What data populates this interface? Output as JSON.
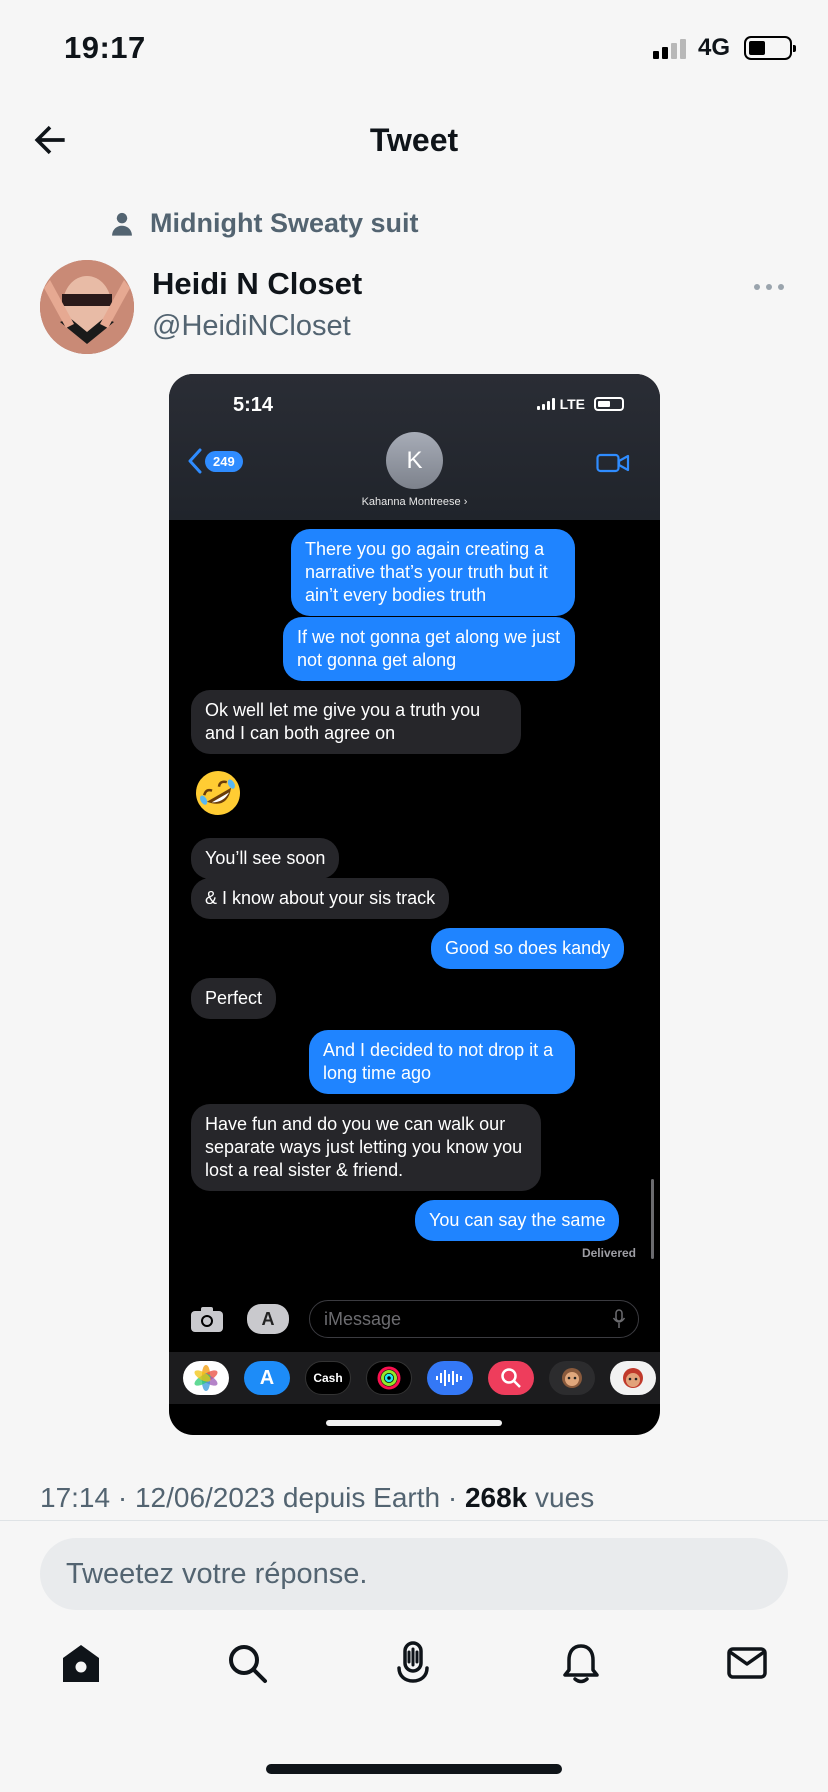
{
  "status_bar": {
    "time": "19:17",
    "network": "4G",
    "signal_bars": 2,
    "battery_level": 0.35
  },
  "nav": {
    "title": "Tweet"
  },
  "social_context": {
    "label": "Midnight Sweaty suit"
  },
  "author": {
    "name": "Heidi N Closet",
    "handle": "@HeidiNCloset"
  },
  "media": {
    "time": "5:14",
    "network": "LTE",
    "back_badge": "249",
    "contact_initial": "K",
    "contact_name": "Kahanna Montreese",
    "messages": [
      {
        "dir": "out",
        "text": "There you go again creating a narrative that’s your truth but it ain’t every bodies truth"
      },
      {
        "dir": "out",
        "text": "If we not gonna get along we just not gonna get along"
      },
      {
        "dir": "in",
        "text": "Ok well let me give you a truth you and I can both agree on"
      },
      {
        "dir": "in",
        "text": "You’ll see soon"
      },
      {
        "dir": "in",
        "text": "& I know about your sis track"
      },
      {
        "dir": "out",
        "text": "Good so does kandy"
      },
      {
        "dir": "in",
        "text": "Perfect"
      },
      {
        "dir": "out",
        "text": "And I decided to not drop it a long time ago"
      },
      {
        "dir": "in",
        "text": "Have fun and do you we can walk our separate ways just letting you know you lost a real sister & friend."
      },
      {
        "dir": "out",
        "text": "You can say the same"
      }
    ],
    "emoji": "rolling-on-floor-laughing-emoji",
    "delivered": "Delivered",
    "input_placeholder": "iMessage",
    "apps": [
      "photos-icon",
      "app-store-icon",
      "apple-cash-icon",
      "activity-icon",
      "audio-icon",
      "search-images-icon",
      "memoji-icon",
      "memoji-icon-2"
    ],
    "cash_label": "Cash"
  },
  "meta": {
    "timestamp": "17:14 · 12/06/2023 depuis Earth · ",
    "views_count": "268k",
    "views_label": " vues"
  },
  "reply": {
    "placeholder": "Tweetez votre réponse."
  },
  "colors": {
    "imessage_blue": "#1f84ff",
    "incoming_gray": "#26262a",
    "muted": "#536471"
  }
}
